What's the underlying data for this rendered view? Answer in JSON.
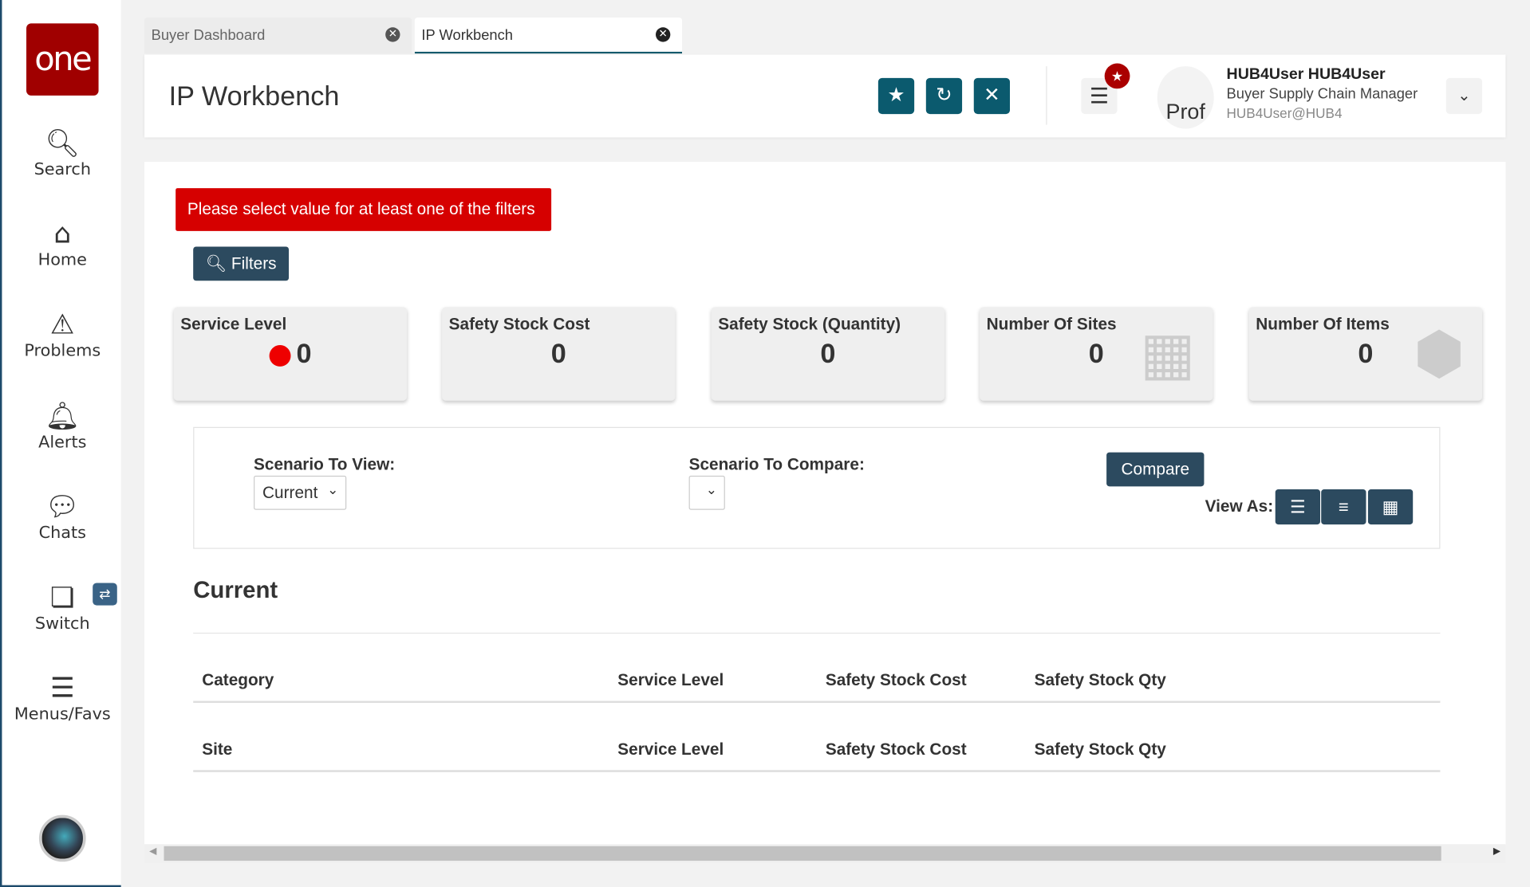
{
  "sidebar": {
    "logo": "one",
    "items": [
      {
        "label": "Search",
        "icon": "search-icon"
      },
      {
        "label": "Home",
        "icon": "home-icon"
      },
      {
        "label": "Problems",
        "icon": "warning-icon"
      },
      {
        "label": "Alerts",
        "icon": "bell-icon"
      },
      {
        "label": "Chats",
        "icon": "chat-icon"
      },
      {
        "label": "Switch",
        "icon": "switch-icon"
      },
      {
        "label": "Menus/Favs",
        "icon": "menu-icon"
      }
    ]
  },
  "tabs": [
    {
      "label": "Buyer Dashboard",
      "active": false
    },
    {
      "label": "IP Workbench",
      "active": true
    }
  ],
  "header": {
    "title": "IP Workbench",
    "user_name": "HUB4User HUB4User",
    "user_role": "Buyer Supply Chain Manager",
    "user_email": "HUB4User@HUB4",
    "avatar_text": "Prof"
  },
  "main": {
    "error": "Please select value for at least one of the filters",
    "filters_label": "Filters",
    "kpis": [
      {
        "label": "Service Level",
        "value": "0",
        "status_color": "#ee0000"
      },
      {
        "label": "Safety Stock Cost",
        "value": "0"
      },
      {
        "label": "Safety Stock (Quantity)",
        "value": "0"
      },
      {
        "label": "Number Of Sites",
        "value": "0"
      },
      {
        "label": "Number Of Items",
        "value": "0"
      }
    ],
    "scenario_view_label": "Scenario To View:",
    "scenario_view_value": "Current",
    "scenario_compare_label": "Scenario To Compare:",
    "scenario_compare_value": "",
    "compare_label": "Compare",
    "view_as_label": "View As:",
    "section_title": "Current",
    "table1_headers": [
      "Category",
      "Service Level",
      "Safety Stock Cost",
      "Safety Stock Qty"
    ],
    "table2_headers": [
      "Site",
      "Service Level",
      "Safety Stock Cost",
      "Safety Stock Qty"
    ]
  },
  "colors": {
    "brand": "#a00000",
    "accent": "#0b5a6e",
    "button": "#2c4a5f",
    "error": "#d60000"
  }
}
